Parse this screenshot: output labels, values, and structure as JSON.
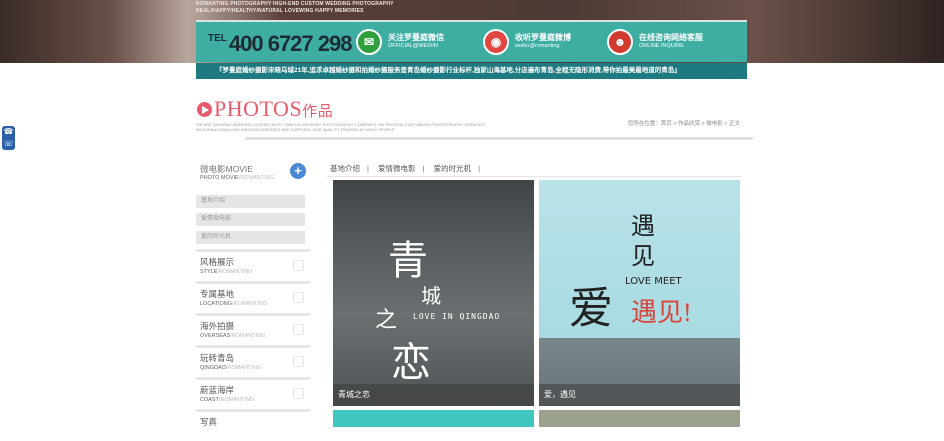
{
  "hero": {
    "tagline1": "ROMANTING PHOTOGRAPHY HIGH-END CUSTOM WEDDING PHOTOGRAPHY",
    "tagline2": "REAL/HAPPY/HEALTHY/NATURAL  LOVEWING HAPPY MEMORIES"
  },
  "contact": {
    "tel_label": "TEL",
    "tel_number": "400 6727 298",
    "weixin": {
      "icon": "wechat-icon",
      "title": "关注罗曼庭微信",
      "sub": "OFFICIAL@WEIXIN",
      "color": "#2fa03b"
    },
    "weibo": {
      "icon": "weibo-icon",
      "title": "收听罗曼庭微博",
      "sub": "weibo@romanting",
      "color": "#e0463f"
    },
    "service": {
      "icon": "qq-icon",
      "title": "在线咨询网络客服",
      "sub": "ONLINE INQUIRE",
      "color": "#d23a2f"
    },
    "bg_color": "#3eaea3"
  },
  "notice": "『罗曼庭婚纱摄影宋晓乌城21年,追求卓越婚纱摄和拍婚纱摄服务是青岛婚纱摄影行业标杆,独家山海基地,分店遍布青岛,全程无隐形消费,带你拍最美最地道的青岛』",
  "header": {
    "title_en": "PHOTOS",
    "title_cn": "作品",
    "subtitle": "WE ARE QINGDAO WEDDING LEADER (MOST FAMOUS WEDDING PHOTOGRAPHY COMPANY), WE PROVIDE CUSTOMIZED PHOTOGRAPHY SERVICES, INCLUDING MAIN KIND WEDDING DRESSES AND SUPPLIES, OUR QUALITY PRAISED BY MANY PEOPLE",
    "breadcrumb": "您所在位置：首页 > 作品欣赏 > 微电影 > 正文"
  },
  "sidebar": {
    "head": {
      "title": "微电影MOVIE",
      "sub_en": "PHOTO MOVIE",
      "sub_brand": "/ROMANTING"
    },
    "subitems": [
      "基地介绍",
      "爱情微电影",
      "爱的时光机"
    ],
    "items": [
      {
        "cn": "风格展示",
        "en": "STYLE",
        "brand": "/ROMANTING"
      },
      {
        "cn": "专属基地",
        "en": "LOCATIONG",
        "brand": "/ROMANTING"
      },
      {
        "cn": "海外拍摄",
        "en": "OVERSEAS",
        "brand": "/ROMANTING"
      },
      {
        "cn": "玩转青岛",
        "en": "QINGDAO",
        "brand": "/ROMANTING"
      },
      {
        "cn": "蔚蓝海岸",
        "en": "COAST",
        "brand": "/ROMANTING"
      },
      {
        "cn": "写真",
        "en": "",
        "brand": ""
      }
    ]
  },
  "tabs": [
    "基地介绍",
    "爱情微电影",
    "爱的时光机"
  ],
  "cards": [
    {
      "caption": "青城之恋",
      "overlay_big": "青",
      "overlay_mid": "城",
      "overlay_small": "之",
      "overlay_last": "恋",
      "overlay_en": "LOVE IN QINGDAO"
    },
    {
      "caption": "爱，遇见",
      "overlay_top": "遇",
      "overlay_top2": "见",
      "overlay_en": "LOVE MEET",
      "overlay_ai": "爱",
      "overlay_red": "遇见!"
    },
    {
      "caption": ""
    },
    {
      "caption": ""
    }
  ]
}
